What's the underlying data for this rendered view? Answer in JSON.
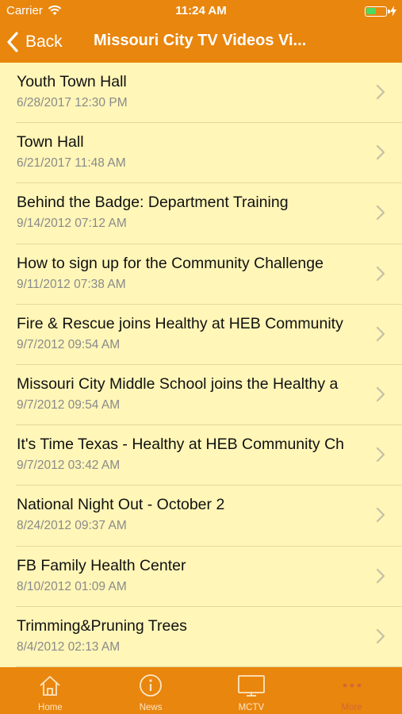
{
  "status_bar": {
    "carrier": "Carrier",
    "time": "11:24 AM",
    "battery_color": "#4CD964"
  },
  "nav": {
    "back_label": "Back",
    "title": "Missouri City TV Videos Vi..."
  },
  "videos": [
    {
      "title": "Youth Town Hall",
      "date": "6/28/2017 12:30 PM"
    },
    {
      "title": "Town Hall",
      "date": "6/21/2017 11:48 AM"
    },
    {
      "title": "Behind the Badge: Department Training",
      "date": "9/14/2012 07:12 AM"
    },
    {
      "title": "How to sign up for the Community Challenge",
      "date": "9/11/2012 07:38 AM"
    },
    {
      "title": "Fire & Rescue joins Healthy at HEB Community",
      "date": "9/7/2012 09:54 AM"
    },
    {
      "title": "Missouri City Middle School joins the Healthy a",
      "date": "9/7/2012 09:54 AM"
    },
    {
      "title": "It's Time Texas - Healthy at HEB Community Ch",
      "date": "9/7/2012 03:42 AM"
    },
    {
      "title": "National Night Out - October 2",
      "date": "8/24/2012 09:37 AM"
    },
    {
      "title": "FB Family Health Center",
      "date": "8/10/2012 01:09 AM"
    },
    {
      "title": "Trimming&Pruning Trees",
      "date": "8/4/2012 02:13 AM"
    }
  ],
  "tabs": [
    {
      "label": "Home",
      "icon": "home-icon"
    },
    {
      "label": "News",
      "icon": "info-icon"
    },
    {
      "label": "MCTV",
      "icon": "tv-icon"
    },
    {
      "label": "More",
      "icon": "more-icon"
    }
  ],
  "colors": {
    "bar": "#E9860D",
    "background": "#FFF6B8",
    "more_tab": "#D4653A"
  }
}
